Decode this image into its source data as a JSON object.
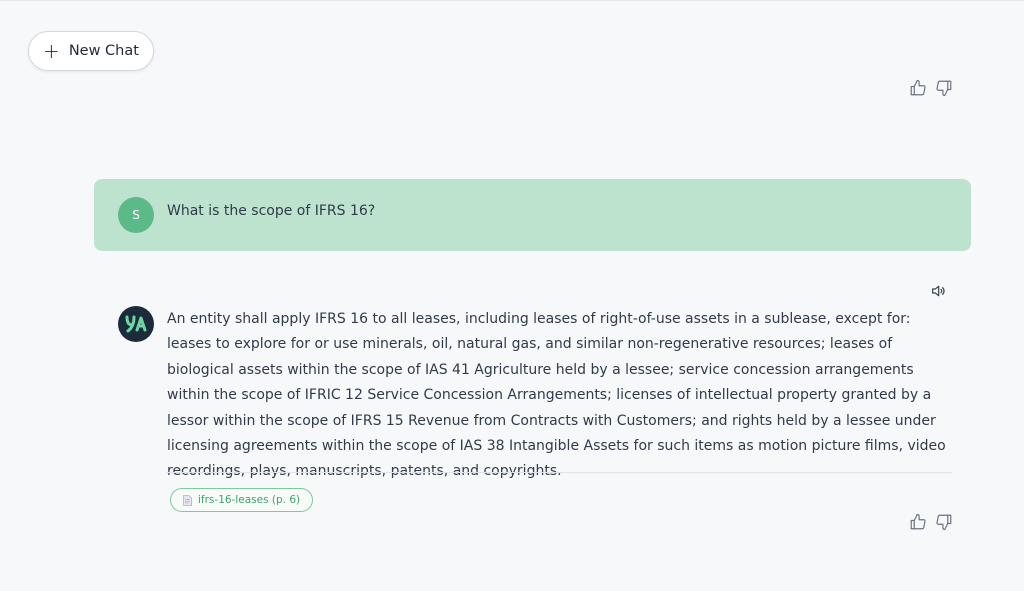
{
  "toolbar": {
    "new_chat_label": "New Chat",
    "new_chat_icon": "plus-icon"
  },
  "messages": [
    {
      "role": "user",
      "avatar_initial": "S",
      "text": "What is the scope of IFRS 16?"
    },
    {
      "role": "assistant",
      "avatar_icon": "assistant-logo-icon",
      "text": "An entity shall apply IFRS 16 to all leases, including leases of right-of-use assets in a sublease, except for: leases to explore for or use minerals, oil, natural gas, and similar non-regenerative resources; leases of biological assets within the scope of IAS 41 Agriculture held by a lessee; service concession arrangements within the scope of IFRIC 12 Service Concession Arrangements; licenses of intellectual property granted by a lessor within the scope of IFRS 15 Revenue from Contracts with Customers; and rights held by a lessee under licensing agreements within the scope of IAS 38 Intangible Assets for such items as motion picture films, video recordings, plays, manuscripts, patents, and copyrights.",
      "source": "ifrs-16-leases (p. 6)"
    }
  ],
  "icons": {
    "thumbs_up": "thumbs-up-icon",
    "thumbs_down": "thumbs-down-icon",
    "speaker": "speaker-icon",
    "document": "document-icon"
  },
  "colors": {
    "user_bubble": "#bde3cf",
    "user_avatar": "#5cb98a",
    "assistant_avatar": "#1c2b3a",
    "accent_green": "#3fa26e",
    "background": "#f7f8fa"
  }
}
